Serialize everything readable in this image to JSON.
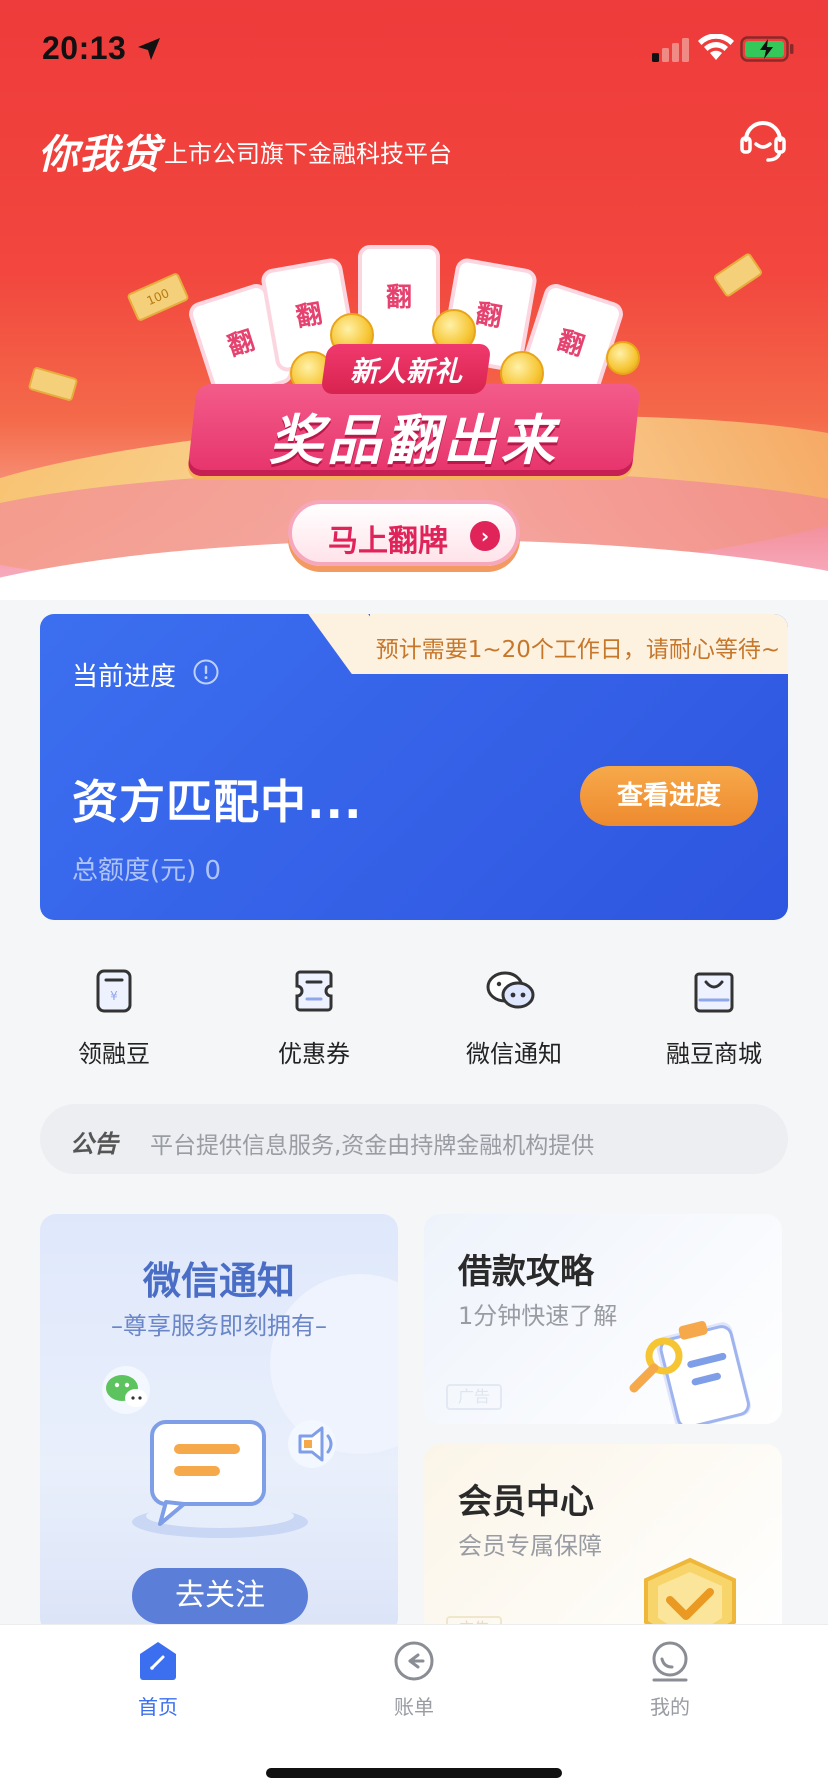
{
  "status_bar": {
    "time": "20:13"
  },
  "header": {
    "brand": "你我贷",
    "tagline": "上市公司旗下金融科技平台"
  },
  "promo": {
    "tag": "新人新礼",
    "title": "奖品翻出来",
    "card_char": "翻",
    "bill_text": "100",
    "button_label": "马上翻牌"
  },
  "progress_card": {
    "notice": "预计需要1~20个工作日，请耐心等待~",
    "label": "当前进度",
    "status": "资方匹配中...",
    "amount_label": "总额度(元) 0",
    "button_label": "查看进度"
  },
  "quick_actions": [
    {
      "label": "领融豆",
      "icon": "bean-card-icon"
    },
    {
      "label": "优惠券",
      "icon": "coupon-icon"
    },
    {
      "label": "微信通知",
      "icon": "wechat-icon"
    },
    {
      "label": "融豆商城",
      "icon": "shopping-bag-icon"
    }
  ],
  "announcement": {
    "tag": "公告",
    "text": "平台提供信息服务,资金由持牌金融机构提供"
  },
  "feature_cards": {
    "wechat": {
      "title": "微信通知",
      "subtitle": "–尊享服务即刻拥有–",
      "button_label": "去关注"
    },
    "loan_guide": {
      "title": "借款攻略",
      "subtitle": "1分钟快速了解",
      "ad_tag": "广告"
    },
    "member_center": {
      "title": "会员中心",
      "subtitle": "会员专属保障",
      "ad_tag": "广告"
    }
  },
  "tabs": [
    {
      "label": "首页",
      "active": true,
      "icon": "home-icon"
    },
    {
      "label": "账单",
      "active": false,
      "icon": "bill-icon"
    },
    {
      "label": "我的",
      "active": false,
      "icon": "profile-icon"
    }
  ],
  "colors": {
    "brand_red": "#ee3b3b",
    "card_blue": "#3c6ff0",
    "accent_orange": "#ee8a2f",
    "active_tab": "#3c6ff0"
  }
}
